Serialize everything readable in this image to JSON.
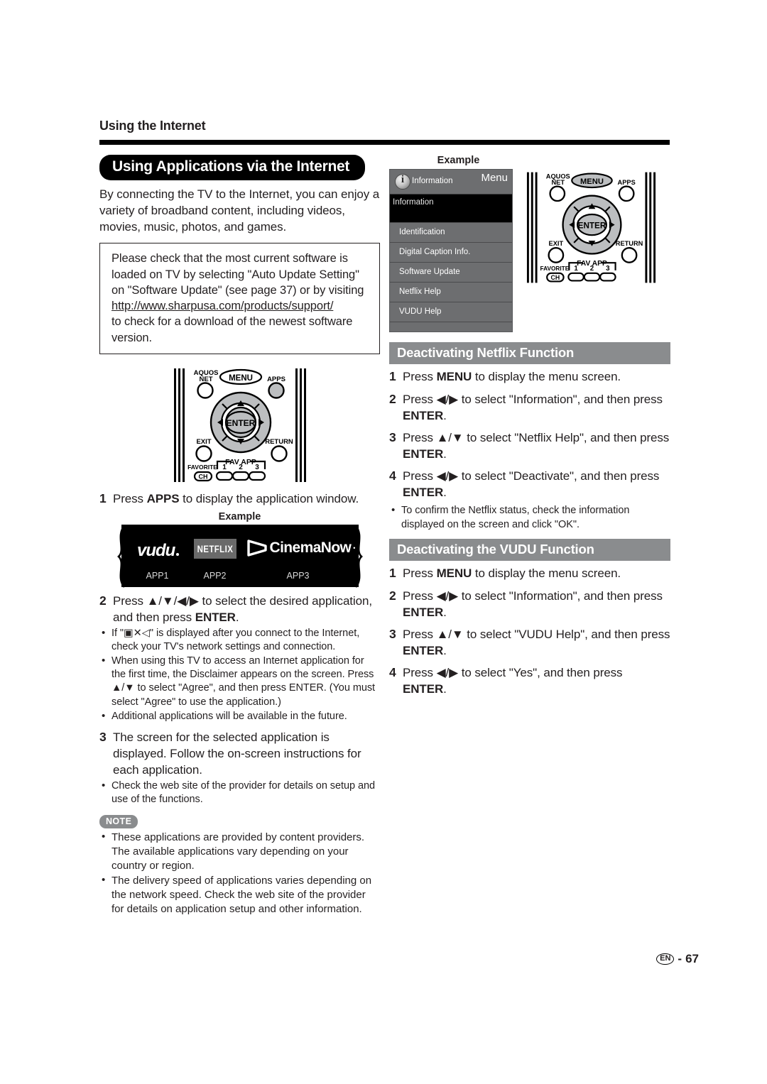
{
  "header": {
    "running_head": "Using the Internet"
  },
  "left": {
    "section_title": "Using Applications via the Internet",
    "intro": "By connecting the TV to the Internet, you can enjoy a variety of broadband content, including videos, movies, music, photos, and games.",
    "boxed_note": {
      "line1": "Please check that the most current software is loaded on TV by selecting \"Auto Update Setting\" on \"Software Update\" (see page 37) or by visiting",
      "url": "http://www.sharpusa.com/products/support/",
      "line2": "to check for a download of the newest software version."
    },
    "steps": [
      {
        "number": "1",
        "text_before": "Press ",
        "bold": "APPS",
        "text_after": " to display the application window."
      },
      {
        "number": "2",
        "line1": "Press ▲/▼/◀/▶ to select the desired application,",
        "line2_before": "and then press ",
        "line2_bold": "ENTER",
        "line2_after": "."
      },
      {
        "number": "3",
        "text": "The screen for the selected application is displayed. Follow the on-screen instructions for each application."
      }
    ],
    "step2_bullets": [
      "If \"▣✕◁\" is displayed after you connect to the Internet, check your TV's network settings and connection.",
      "When using this TV to access an Internet application for the first time, the Disclaimer appears on the screen. Press ▲/▼ to select \"Agree\", and then press ENTER. (You must select \"Agree\" to use the application.)",
      "Additional applications will be available in the future."
    ],
    "step3_bullets": [
      "Check the web site of the provider for details on setup and use of the functions."
    ],
    "example_label": "Example",
    "apps": [
      {
        "logo": "vudu",
        "label": "APP1"
      },
      {
        "logo": "NETFLIX",
        "label": "APP2"
      },
      {
        "logo": "CinemaNow",
        "label": "APP3"
      }
    ],
    "note": {
      "badge": "NOTE",
      "items": [
        "These applications are provided by content providers. The available applications vary depending on your country or region.",
        "The delivery speed of applications varies depending on the network speed. Check the web site of the provider for details on application setup and other information."
      ]
    }
  },
  "right": {
    "example_label": "Example",
    "tv_menu": {
      "icon_label": "Information",
      "menu_label": "Menu",
      "selected_row": "Information",
      "rows": [
        "Identification",
        "Digital Caption Info.",
        "Software Update",
        "Netflix Help",
        "VUDU Help"
      ]
    },
    "netflix_section": {
      "title": "Deactivating Netflix Function",
      "steps": [
        {
          "number": "1",
          "before": "Press ",
          "bold": "MENU",
          "after": " to display the menu screen."
        },
        {
          "number": "2",
          "line1": "Press ◀/▶ to select \"Information\", and then press",
          "bold": "ENTER",
          "tail": "."
        },
        {
          "number": "3",
          "line1": "Press ▲/▼ to select \"Netflix Help\", and then press",
          "bold": "ENTER",
          "tail": "."
        },
        {
          "number": "4",
          "line1": "Press ◀/▶ to select \"Deactivate\", and then press",
          "bold": "ENTER",
          "tail": "."
        }
      ],
      "bullets": [
        "To confirm the Netflix status, check the information displayed on the screen and click \"OK\"."
      ]
    },
    "vudu_section": {
      "title": "Deactivating the VUDU Function",
      "steps": [
        {
          "number": "1",
          "before": "Press ",
          "bold": "MENU",
          "after": " to display the menu screen."
        },
        {
          "number": "2",
          "line1": "Press ◀/▶ to select \"Information\", and then press",
          "bold": "ENTER",
          "tail": "."
        },
        {
          "number": "3",
          "line1": "Press ▲/▼ to select \"VUDU Help\", and then press",
          "bold": "ENTER",
          "tail": "."
        },
        {
          "number": "4",
          "line1": "Press ◀/▶ to select \"Yes\", and then press",
          "bold": "ENTER",
          "tail": "."
        }
      ]
    }
  },
  "remote": {
    "aquos_net": "AQUOS\nNET",
    "aquos_net_l1": "AQUOS",
    "aquos_net_l2": "NET",
    "menu": "MENU",
    "apps": "APPS",
    "enter": "ENTER",
    "exit": "EXIT",
    "return": "RETURN",
    "favorite": "FAVORITE",
    "ch": "CH",
    "fav_app": "FAV APP",
    "fav1": "1",
    "fav2": "2",
    "fav3": "3"
  },
  "footer": {
    "lang": "EN",
    "dash": "-",
    "page": "67"
  },
  "colors": {
    "section_header_gray": "#8a8c8e",
    "menu_gray": "#6d6e70",
    "selected_black": "#000000",
    "text": "#231f20"
  }
}
